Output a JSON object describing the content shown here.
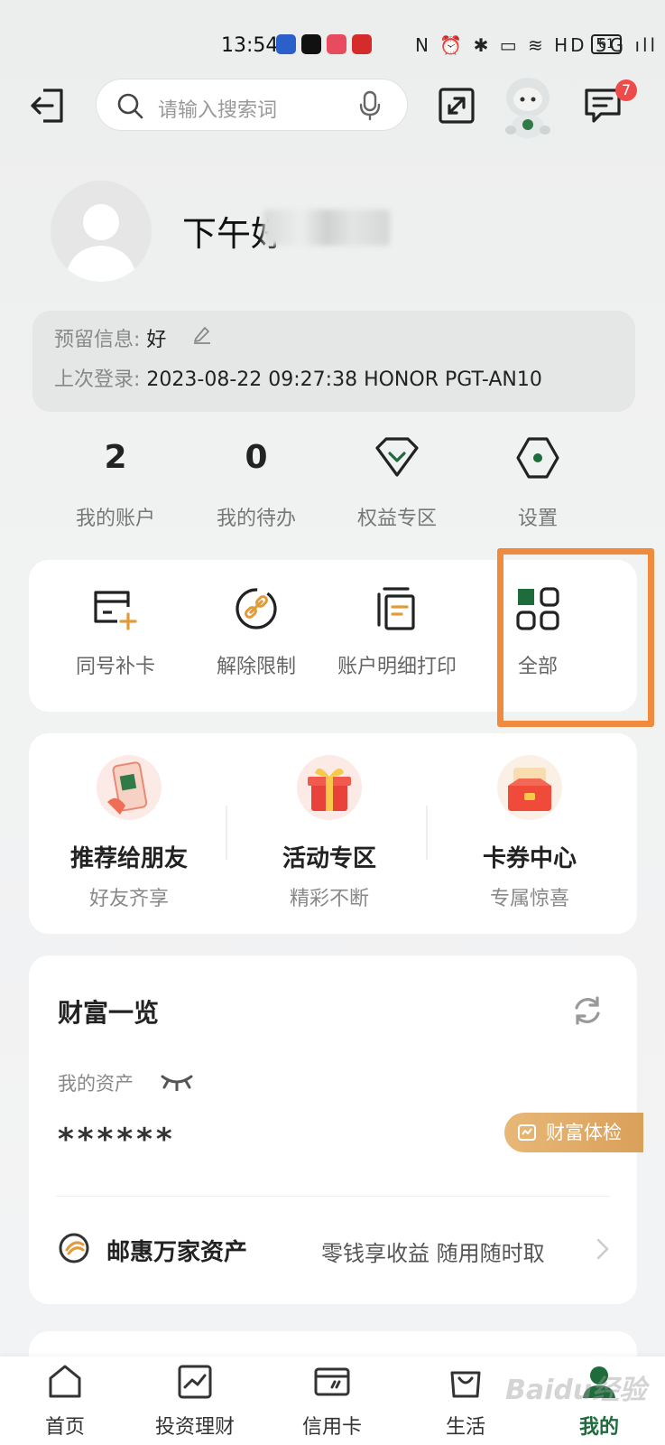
{
  "status_bar": {
    "time": "13:54",
    "sys_icons": "N ⏰ ✱ ▭ ≋ HD 5G ıll",
    "battery": "61"
  },
  "search": {
    "placeholder": "请输入搜索词"
  },
  "header": {
    "message_badge": "7"
  },
  "profile": {
    "name": "下午好"
  },
  "info": {
    "reserved_label": "预留信息:",
    "reserved_value": "好",
    "last_login_label": "上次登录:",
    "last_login_value": "2023-08-22 09:27:38 HONOR PGT-AN10"
  },
  "stats": [
    {
      "value": "2",
      "label": "我的账户"
    },
    {
      "value": "0",
      "label": "我的待办"
    },
    {
      "icon": "diamond-icon",
      "label": "权益专区"
    },
    {
      "icon": "hexagon-settings-icon",
      "label": "设置"
    }
  ],
  "services": [
    {
      "icon": "card-add-icon",
      "label": "同号补卡"
    },
    {
      "icon": "unlock-link-icon",
      "label": "解除限制"
    },
    {
      "icon": "statement-print-icon",
      "label": "账户明细打印"
    },
    {
      "icon": "grid-all-icon",
      "label": "全部"
    }
  ],
  "promos": [
    {
      "title": "推荐给朋友",
      "subtitle": "好友齐享"
    },
    {
      "title": "活动专区",
      "subtitle": "精彩不断"
    },
    {
      "title": "卡券中心",
      "subtitle": "专属惊喜"
    }
  ],
  "wealth": {
    "title": "财富一览",
    "asset_label": "我的资产",
    "asset_value": "******",
    "checkup_label": "财富体检"
  },
  "fund": {
    "name": "邮惠万家资产",
    "description": "零钱享收益 随用随时取"
  },
  "nav": [
    {
      "label": "首页"
    },
    {
      "label": "投资理财"
    },
    {
      "label": "信用卡"
    },
    {
      "label": "生活"
    },
    {
      "label": "我的",
      "active": true
    }
  ],
  "watermark": "Baidu经验",
  "colors": {
    "accent_green": "#1e6b3b",
    "highlight_orange": "#f08a3c",
    "badge_red": "#ee4b4b",
    "checkup_gold": "#d9a05a"
  }
}
